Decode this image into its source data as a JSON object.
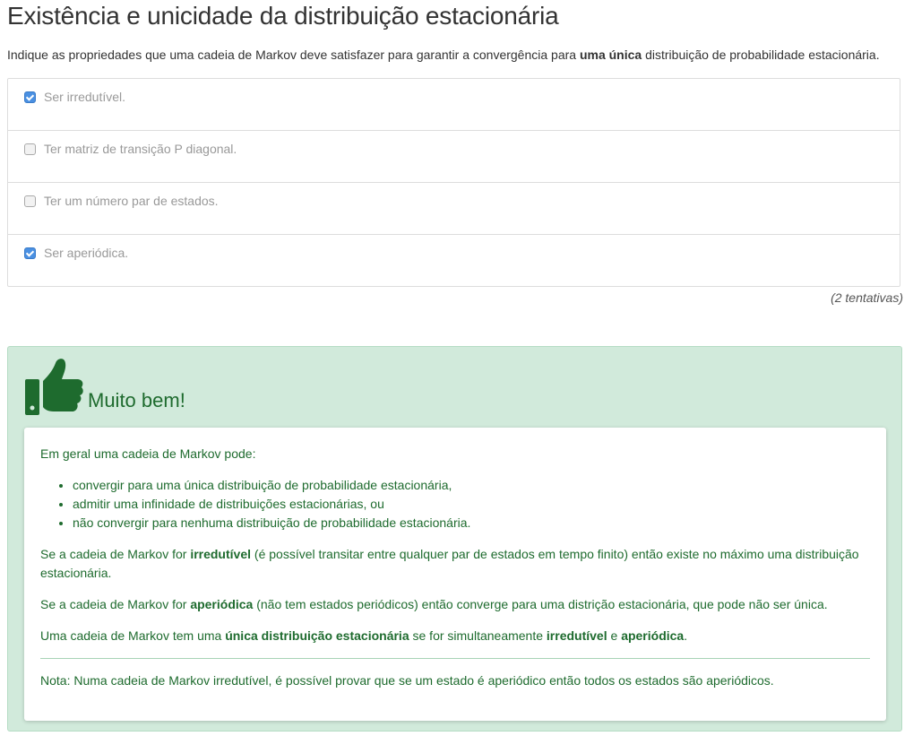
{
  "page": {
    "title": "Existência e unicidade da distribuição estacionária",
    "question_prefix": "Indique as propriedades que uma cadeia de Markov deve satisfazer para garantir a convergência para ",
    "question_bold": "uma única",
    "question_suffix": " distribuição de probabilidade estacionária."
  },
  "options": [
    {
      "label": "Ser irredutível.",
      "checked": true
    },
    {
      "label": "Ter matriz de transição P diagonal.",
      "checked": false
    },
    {
      "label": "Ter um número par de estados.",
      "checked": false
    },
    {
      "label": "Ser aperiódica.",
      "checked": true
    }
  ],
  "attempts": "(2 tentativas)",
  "feedback": {
    "icon": "thumbs-up-icon",
    "title": "Muito bem!",
    "intro": "Em geral uma cadeia de Markov pode:",
    "bullets": [
      "convergir para uma única distribuição de probabilidade estacionária,",
      "admitir uma infinidade de distribuições estacionárias, ou",
      "não convergir para nenhuma distribuição de probabilidade estacionária."
    ],
    "p1_a": "Se a cadeia de Markov for ",
    "p1_b": "irredutível",
    "p1_c": " (é possível transitar entre qualquer par de estados em tempo finito) então existe no máximo uma distribuição estacionária.",
    "p2_a": "Se a cadeia de Markov for ",
    "p2_b": "aperiódica",
    "p2_c": " (não tem estados periódicos) então converge para uma distrição estacionária, que pode não ser única.",
    "p3_a": "Uma cadeia de Markov tem uma ",
    "p3_b": "única distribuição estacionária",
    "p3_c": " se for simultaneamente ",
    "p3_d": "irredutível",
    "p3_e": " e ",
    "p3_f": "aperiódica",
    "p3_g": ".",
    "note": "Nota: Numa cadeia de Markov irredutível, é possível provar que se um estado é aperiódico então todos os estados são aperiódicos."
  },
  "colors": {
    "accent_green": "#1e6b2e",
    "feedback_bg": "#d1eadb",
    "checkbox_checked": "#4a90e2"
  }
}
